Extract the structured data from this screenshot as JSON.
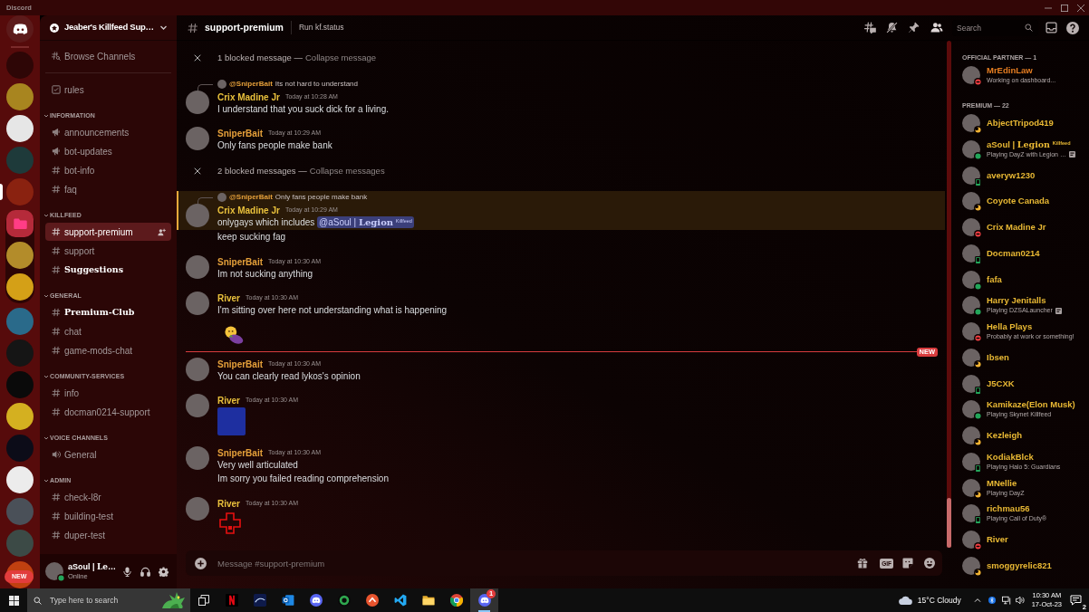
{
  "window": {
    "title": "Discord"
  },
  "servers": [
    {
      "kind": "home",
      "selected": false
    },
    {
      "kind": "server",
      "color": "#2e0606",
      "selected": false
    },
    {
      "kind": "server",
      "color": "#a8851f",
      "selected": false
    },
    {
      "kind": "server",
      "color": "#e6e6e6",
      "selected": false
    },
    {
      "kind": "server",
      "color": "#1e3a3a",
      "selected": false
    },
    {
      "kind": "server",
      "color": "#8a2210",
      "selected": true
    },
    {
      "kind": "folder",
      "expanded": true,
      "selected": false,
      "children": [
        {
          "kind": "server",
          "color": "#b38c2a",
          "selected": false
        },
        {
          "kind": "server",
          "color": "#d4a017",
          "selected": false
        }
      ]
    },
    {
      "kind": "server",
      "color": "#2a6a8a",
      "selected": false
    },
    {
      "kind": "server",
      "color": "#151515",
      "selected": false
    },
    {
      "kind": "server",
      "color": "#0a0a0a",
      "selected": false
    },
    {
      "kind": "server",
      "color": "#d4b020",
      "selected": false
    },
    {
      "kind": "server",
      "color": "#0c0c18",
      "selected": false
    },
    {
      "kind": "server",
      "color": "#ececec",
      "selected": false
    },
    {
      "kind": "server",
      "color": "#4a5058",
      "selected": false
    },
    {
      "kind": "server",
      "color": "#3c4a46",
      "selected": false
    },
    {
      "kind": "server",
      "color": "#c04010",
      "selected": false
    }
  ],
  "rail_badge": "NEW",
  "server_header": {
    "name": "Jeaber's Killfeed Sup…"
  },
  "browse": {
    "label": "Browse Channels"
  },
  "channels": [
    {
      "kind": "rules",
      "name": "rules",
      "selected": false,
      "unread": false
    },
    {
      "kind": "category",
      "name": "INFORMATION",
      "expanded": true,
      "children": [
        {
          "kind": "announcement",
          "name": "announcements",
          "selected": false,
          "unread": false
        },
        {
          "kind": "announcement",
          "name": "bot-updates",
          "selected": false,
          "unread": false
        },
        {
          "kind": "text",
          "name": "bot-info",
          "selected": false,
          "unread": false
        },
        {
          "kind": "text",
          "name": "faq",
          "selected": false,
          "unread": false
        }
      ]
    },
    {
      "kind": "category",
      "name": "KILLFEED",
      "expanded": true,
      "children": [
        {
          "kind": "text",
          "name": "support-premium",
          "selected": true,
          "unread": false
        },
        {
          "kind": "text",
          "name": "support",
          "selected": false,
          "unread": false
        },
        {
          "kind": "text",
          "name": "Suggestions",
          "selected": false,
          "unread": true
        }
      ]
    },
    {
      "kind": "category",
      "name": "GENERAL",
      "expanded": true,
      "children": [
        {
          "kind": "text",
          "name": "Premium-Club",
          "selected": false,
          "unread": true
        },
        {
          "kind": "text",
          "name": "chat",
          "selected": false,
          "unread": false
        },
        {
          "kind": "text",
          "name": "game-mods-chat",
          "selected": false,
          "unread": false
        }
      ]
    },
    {
      "kind": "category",
      "name": "COMMUNITY-SERVICES",
      "expanded": true,
      "children": [
        {
          "kind": "text",
          "name": "info",
          "selected": false,
          "unread": false
        },
        {
          "kind": "text",
          "name": "docman0214-support",
          "selected": false,
          "unread": false
        }
      ]
    },
    {
      "kind": "category",
      "name": "VOICE CHANNELS",
      "expanded": true,
      "children": [
        {
          "kind": "voice",
          "name": "General",
          "selected": false,
          "unread": false
        }
      ]
    },
    {
      "kind": "category",
      "name": "ADMIN",
      "expanded": true,
      "children": [
        {
          "kind": "text",
          "name": "check-l8r",
          "selected": false,
          "unread": false
        },
        {
          "kind": "text",
          "name": "building-test",
          "selected": false,
          "unread": false
        },
        {
          "kind": "text",
          "name": "duper-test",
          "selected": false,
          "unread": false
        }
      ]
    }
  ],
  "user_panel": {
    "name": "aSoul | **Le**…",
    "status_text": "Online",
    "presence": {
      "kind": "online"
    }
  },
  "header": {
    "channel": "support-premium",
    "topic": "Run kf.status",
    "search_placeholder": "Search"
  },
  "messages": [
    {
      "kind": "blocked",
      "text": "1 blocked message —",
      "action": "Collapse message"
    },
    {
      "kind": "message",
      "author": "Crix Madine Jr",
      "color": "#e9c13c",
      "time": "Today at 10:28 AM",
      "highlighted": false,
      "reply": {
        "author": "@SniperBait",
        "color": "#e5a03a",
        "text": "Its not hard to understand"
      },
      "content": [
        {
          "kind": "text",
          "text": "I understand that you suck dick for a living."
        }
      ]
    },
    {
      "kind": "message",
      "author": "SniperBait",
      "color": "#e5a03a",
      "time": "Today at 10:29 AM",
      "highlighted": false,
      "content": [
        {
          "kind": "text",
          "text": "Only fans people make bank"
        }
      ]
    },
    {
      "kind": "blocked",
      "text": "2 blocked messages —",
      "action": "Collapse messages"
    },
    {
      "kind": "message",
      "author": "Crix Madine Jr",
      "color": "#e9c13c",
      "time": "Today at 10:29 AM",
      "highlighted": true,
      "reply": {
        "author": "@SniperBait",
        "color": "#e5a03a",
        "text": "Only fans people make bank"
      },
      "content": [
        {
          "kind": "text",
          "text": "onlygays which includes",
          "mention": "@aSoul | **Legion** $^{Killfeed}$"
        }
      ]
    },
    {
      "kind": "continuation",
      "highlighted": false,
      "content": [
        {
          "kind": "text",
          "text": "keep sucking fag"
        }
      ]
    },
    {
      "kind": "message",
      "author": "SniperBait",
      "color": "#e5a03a",
      "time": "Today at 10:30 AM",
      "highlighted": false,
      "content": [
        {
          "kind": "text",
          "text": "Im not sucking anything"
        }
      ]
    },
    {
      "kind": "message",
      "author": "River",
      "color": "#e9c13c",
      "time": "Today at 10:30 AM",
      "highlighted": false,
      "content": [
        {
          "kind": "text",
          "text": "I'm sitting over here not understanding what is happening"
        },
        {
          "kind": "emoji"
        }
      ]
    },
    {
      "kind": "new_divider",
      "label": "NEW"
    },
    {
      "kind": "message",
      "author": "SniperBait",
      "color": "#e5a03a",
      "time": "Today at 10:30 AM",
      "highlighted": false,
      "content": [
        {
          "kind": "text",
          "text": "You can clearly read lykos's opinion"
        }
      ]
    },
    {
      "kind": "message",
      "author": "River",
      "color": "#e9c13c",
      "time": "Today at 10:30 AM",
      "highlighted": false,
      "content": [
        {
          "kind": "image"
        }
      ]
    },
    {
      "kind": "message",
      "author": "SniperBait",
      "color": "#e5a03a",
      "time": "Today at 10:30 AM",
      "highlighted": false,
      "content": [
        {
          "kind": "text",
          "text": "Very well articulated"
        }
      ]
    },
    {
      "kind": "continuation",
      "highlighted": false,
      "content": [
        {
          "kind": "text",
          "text": "Im sorry you failed reading comprehension"
        }
      ]
    },
    {
      "kind": "message",
      "author": "River",
      "color": "#e9c13c",
      "time": "Today at 10:30 AM",
      "highlighted": false,
      "content": [
        {
          "kind": "emoji"
        }
      ]
    }
  ],
  "composer": {
    "placeholder": "Message #support-premium",
    "gif_label": "GIF"
  },
  "members": {
    "groups": [
      {
        "title": "OFFICIAL PARTNER — 1",
        "members": [
          {
            "name": "MrEdinLaw",
            "color": "#e67e22",
            "presence": {
              "kind": "dnd"
            },
            "activity": "Working on dashboard...",
            "details_icon": false
          }
        ]
      },
      {
        "title": "PREMIUM — 22",
        "members": [
          {
            "name": "AbjectTripod419",
            "color": "#e9b934",
            "presence": {
              "kind": "idle"
            }
          },
          {
            "name": "aSoul | **Legion** $^{Killfeed}$",
            "color": "#e9b934",
            "presence": {
              "kind": "online"
            },
            "activity": "Playing DayZ with Legion …",
            "details_icon": true
          },
          {
            "name": "averyw1230",
            "color": "#e9b934",
            "presence": {
              "kind": "mobile"
            }
          },
          {
            "name": "Coyote Canada",
            "color": "#e9b934",
            "presence": {
              "kind": "idle"
            }
          },
          {
            "name": "Crix Madine Jr",
            "color": "#e9b934",
            "presence": {
              "kind": "dnd"
            }
          },
          {
            "name": "Docman0214",
            "color": "#e9b934",
            "presence": {
              "kind": "mobile"
            }
          },
          {
            "name": "fafa",
            "color": "#e9b934",
            "presence": {
              "kind": "online"
            }
          },
          {
            "name": "Harry Jenitalls",
            "color": "#e9b934",
            "presence": {
              "kind": "online"
            },
            "activity": "Playing DZSALauncher",
            "details_icon": true
          },
          {
            "name": "Hella Plays",
            "color": "#e9b934",
            "presence": {
              "kind": "dnd"
            },
            "activity": "Probably at work or something!",
            "details_icon": false
          },
          {
            "name": "Ibsen",
            "color": "#e9b934",
            "presence": {
              "kind": "idle"
            }
          },
          {
            "name": "J5CXK",
            "color": "#e9b934",
            "presence": {
              "kind": "mobile"
            }
          },
          {
            "name": "Kamikaze(Elon Musk)",
            "color": "#e9b934",
            "presence": {
              "kind": "online"
            },
            "activity": "Playing Skynet Killfeed",
            "details_icon": false
          },
          {
            "name": "Kezleigh",
            "color": "#e9b934",
            "presence": {
              "kind": "idle"
            }
          },
          {
            "name": "KodiakBlck",
            "color": "#e9b934",
            "presence": {
              "kind": "mobile"
            },
            "activity": "Playing Halo 5: Guardians",
            "details_icon": false
          },
          {
            "name": "MNellie",
            "color": "#e9b934",
            "presence": {
              "kind": "idle"
            },
            "activity": "Playing DayZ",
            "details_icon": false
          },
          {
            "name": "richmau56",
            "color": "#e9b934",
            "presence": {
              "kind": "mobile"
            },
            "activity": "Playing Call of Duty®",
            "details_icon": false
          },
          {
            "name": "River",
            "color": "#e9b934",
            "presence": {
              "kind": "dnd"
            }
          },
          {
            "name": "smoggyrelic821",
            "color": "#e9b934",
            "presence": {
              "kind": "idle"
            }
          }
        ]
      }
    ]
  },
  "taskbar": {
    "search_placeholder": "Type here to search",
    "apps": [
      {
        "selected": false
      },
      {
        "selected": false
      },
      {
        "selected": false
      },
      {
        "selected": false
      },
      {
        "selected": false
      },
      {
        "selected": false
      },
      {
        "selected": false
      },
      {
        "selected": false
      },
      {
        "selected": false
      },
      {
        "selected": true,
        "badge": "1"
      }
    ],
    "weather": "15°C Cloudy",
    "time": "10:30 AM",
    "date": "17-Oct-23",
    "notification_count": "2"
  }
}
